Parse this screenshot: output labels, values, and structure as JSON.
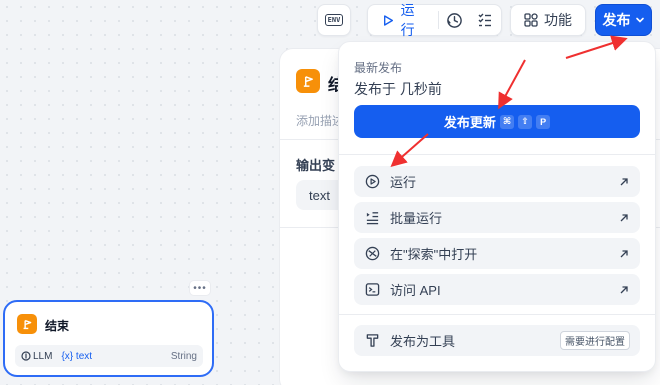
{
  "toolbar": {
    "env_label": "ENV",
    "run_label": "运行",
    "features_label": "功能",
    "publish_label": "发布"
  },
  "panel": {
    "title": "结",
    "description_placeholder": "添加描述",
    "output_vars_label": "输出变",
    "var_name": "text"
  },
  "end_node": {
    "title": "结束",
    "source": "LLM",
    "variable": "{x} text",
    "type": "String",
    "more": "•••"
  },
  "dropdown": {
    "section_label": "最新发布",
    "published_time": "发布于 几秒前",
    "update_button": "发布更新",
    "shortcut_keys": [
      "⌘",
      "⇧",
      "P"
    ],
    "items": [
      {
        "label": "运行",
        "icon": "play-circle-icon"
      },
      {
        "label": "批量运行",
        "icon": "batch-list-icon"
      },
      {
        "label": "在\"探索\"中打开",
        "icon": "compass-icon"
      },
      {
        "label": "访问 API",
        "icon": "terminal-icon"
      }
    ],
    "tool_item": {
      "label": "发布为工具",
      "badge": "需要进行配置",
      "icon": "tool-icon"
    }
  },
  "colors": {
    "accent": "#155eef",
    "node_icon": "#f79009",
    "annotation": "#ef3030"
  }
}
